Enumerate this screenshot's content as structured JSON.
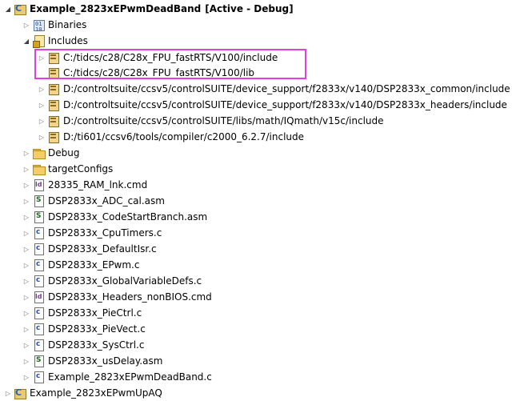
{
  "project": {
    "name": "Example_2823xEPwmDeadBand",
    "status": "[Active - Debug]"
  },
  "nodes": {
    "binaries": "Binaries",
    "includes": "Includes",
    "inc1": "C:/tidcs/c28/C28x_FPU_fastRTS/V100/include",
    "inc2": "C:/tidcs/c28/C28x_FPU_fastRTS/V100/lib",
    "inc3": "D:/controltsuite/ccsv5/controlSUITE/device_support/f2833x/v140/DSP2833x_common/include",
    "inc4": "D:/controltsuite/ccsv5/controlSUITE/device_support/f2833x/v140/DSP2833x_headers/include",
    "inc5": "D:/controltsuite/ccsv5/controlSUITE/libs/math/IQmath/v15c/include",
    "inc6": "D:/ti601/ccsv6/tools/compiler/c2000_6.2.7/include",
    "debug": "Debug",
    "targetConfigs": "targetConfigs",
    "f1": "28335_RAM_lnk.cmd",
    "f2": "DSP2833x_ADC_cal.asm",
    "f3": "DSP2833x_CodeStartBranch.asm",
    "f4": "DSP2833x_CpuTimers.c",
    "f5": "DSP2833x_DefaultIsr.c",
    "f6": "DSP2833x_EPwm.c",
    "f7": "DSP2833x_GlobalVariableDefs.c",
    "f8": "DSP2833x_Headers_nonBIOS.cmd",
    "f9": "DSP2833x_PieCtrl.c",
    "f10": "DSP2833x_PieVect.c",
    "f11": "DSP2833x_SysCtrl.c",
    "f12": "DSP2833x_usDelay.asm",
    "f13": "Example_2823xEPwmDeadBand.c",
    "project2": "Example_2823xEPwmUpAQ"
  },
  "colors": {
    "highlight": "#e040e0"
  }
}
